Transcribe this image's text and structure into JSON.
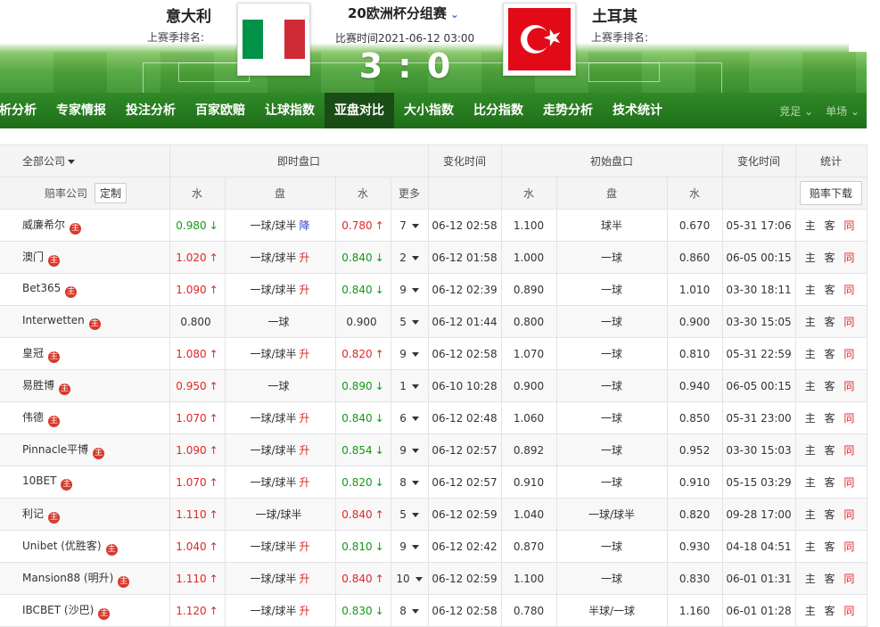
{
  "header": {
    "home_team": "意大利",
    "away_team": "土耳其",
    "home_rank_label": "上赛季排名:",
    "away_rank_label": "上赛季排名:",
    "league": "20欧洲杯分组赛",
    "match_time": "比赛时间2021-06-12 03:00",
    "score": "3 : 0",
    "colors": {
      "italy_green": "#009246",
      "italy_white": "#ffffff",
      "italy_red": "#ce2b37",
      "turkey_red": "#e30a17",
      "pitch_green": "#3d922f"
    }
  },
  "nav": {
    "items": [
      "析分析",
      "专家情报",
      "投注分析",
      "百家欧赔",
      "让球指数",
      "亚盘对比",
      "大小指数",
      "比分指数",
      "走势分析",
      "技术统计"
    ],
    "active": "亚盘对比",
    "right": [
      "竞足",
      "单场"
    ]
  },
  "table": {
    "header1": {
      "company_filter": "全部公司",
      "live": "即时盘口",
      "change_time": "变化时间",
      "initial": "初始盘口",
      "change_time2": "变化时间",
      "stats": "统计"
    },
    "header2": {
      "company": "赔率公司",
      "custom": "定制",
      "water": "水",
      "handicap": "盘",
      "water2": "水",
      "more": "更多",
      "iwater": "水",
      "ihandicap": "盘",
      "iwater2": "水",
      "download": "赔率下载"
    },
    "badge_char": "主",
    "stat_labels": {
      "home": "主",
      "away": "客",
      "same": "同"
    },
    "rows": [
      {
        "name": "威廉希尔",
        "w1": "0.980",
        "w1d": "down",
        "pan": "一球/球半",
        "pand": "降",
        "pandc": "blue",
        "w2": "0.780",
        "w2d": "up",
        "more": "7",
        "time": "06-12 02:58",
        "iw1": "1.100",
        "ipan": "球半",
        "iw2": "0.670",
        "itime": "05-31 17:06"
      },
      {
        "name": "澳门",
        "w1": "1.020",
        "w1d": "up",
        "pan": "一球/球半",
        "pand": "升",
        "pandc": "red",
        "w2": "0.840",
        "w2d": "down",
        "more": "2",
        "time": "06-12 01:58",
        "iw1": "1.000",
        "ipan": "一球",
        "iw2": "0.860",
        "itime": "06-05 00:15"
      },
      {
        "name": "Bet365",
        "w1": "1.090",
        "w1d": "up",
        "pan": "一球/球半",
        "pand": "升",
        "pandc": "red",
        "w2": "0.840",
        "w2d": "down",
        "more": "9",
        "time": "06-12 02:39",
        "iw1": "0.890",
        "ipan": "一球",
        "iw2": "1.010",
        "itime": "03-30 18:11"
      },
      {
        "name": "Interwetten",
        "w1": "0.800",
        "w1d": "",
        "pan": "一球",
        "pand": "",
        "pandc": "",
        "w2": "0.900",
        "w2d": "",
        "more": "5",
        "time": "06-12 01:44",
        "iw1": "0.800",
        "ipan": "一球",
        "iw2": "0.900",
        "itime": "03-30 15:05"
      },
      {
        "name": "皇冠",
        "w1": "1.080",
        "w1d": "up",
        "pan": "一球/球半",
        "pand": "升",
        "pandc": "red",
        "w2": "0.820",
        "w2d": "up",
        "more": "9",
        "time": "06-12 02:58",
        "iw1": "1.070",
        "ipan": "一球",
        "iw2": "0.810",
        "itime": "05-31 22:59"
      },
      {
        "name": "易胜博",
        "w1": "0.950",
        "w1d": "up",
        "pan": "一球",
        "pand": "",
        "pandc": "",
        "w2": "0.890",
        "w2d": "down",
        "more": "1",
        "time": "06-10 10:28",
        "iw1": "0.900",
        "ipan": "一球",
        "iw2": "0.940",
        "itime": "06-05 00:15"
      },
      {
        "name": "伟德",
        "w1": "1.070",
        "w1d": "up",
        "pan": "一球/球半",
        "pand": "升",
        "pandc": "red",
        "w2": "0.840",
        "w2d": "down",
        "more": "6",
        "time": "06-12 02:48",
        "iw1": "1.060",
        "ipan": "一球",
        "iw2": "0.850",
        "itime": "05-31 23:00"
      },
      {
        "name": "Pinnacle平博",
        "w1": "1.090",
        "w1d": "up",
        "pan": "一球/球半",
        "pand": "升",
        "pandc": "red",
        "w2": "0.854",
        "w2d": "down",
        "more": "9",
        "time": "06-12 02:57",
        "iw1": "0.892",
        "ipan": "一球",
        "iw2": "0.952",
        "itime": "03-30 15:03"
      },
      {
        "name": "10BET",
        "w1": "1.070",
        "w1d": "up",
        "pan": "一球/球半",
        "pand": "升",
        "pandc": "red",
        "w2": "0.820",
        "w2d": "down",
        "more": "8",
        "time": "06-12 02:57",
        "iw1": "0.910",
        "ipan": "一球",
        "iw2": "0.910",
        "itime": "05-15 03:29"
      },
      {
        "name": "利记",
        "w1": "1.110",
        "w1d": "up",
        "pan": "一球/球半",
        "pand": "",
        "pandc": "",
        "w2": "0.840",
        "w2d": "up",
        "more": "5",
        "time": "06-12 02:59",
        "iw1": "1.040",
        "ipan": "一球/球半",
        "iw2": "0.820",
        "itime": "09-28 17:00"
      },
      {
        "name": "Unibet (优胜客)",
        "w1": "1.040",
        "w1d": "up",
        "pan": "一球/球半",
        "pand": "升",
        "pandc": "red",
        "w2": "0.810",
        "w2d": "down",
        "more": "9",
        "time": "06-12 02:42",
        "iw1": "0.870",
        "ipan": "一球",
        "iw2": "0.930",
        "itime": "04-18 04:51"
      },
      {
        "name": "Mansion88 (明升)",
        "w1": "1.110",
        "w1d": "up",
        "pan": "一球/球半",
        "pand": "升",
        "pandc": "red",
        "w2": "0.840",
        "w2d": "up",
        "more": "10",
        "time": "06-12 02:59",
        "iw1": "1.100",
        "ipan": "一球",
        "iw2": "0.830",
        "itime": "06-01 01:31"
      },
      {
        "name": "IBCBET (沙巴)",
        "w1": "1.120",
        "w1d": "up",
        "pan": "一球/球半",
        "pand": "升",
        "pandc": "red",
        "w2": "0.830",
        "w2d": "down",
        "more": "8",
        "time": "06-12 02:58",
        "iw1": "0.780",
        "ipan": "半球/一球",
        "iw2": "1.160",
        "itime": "06-01 01:28"
      }
    ]
  }
}
